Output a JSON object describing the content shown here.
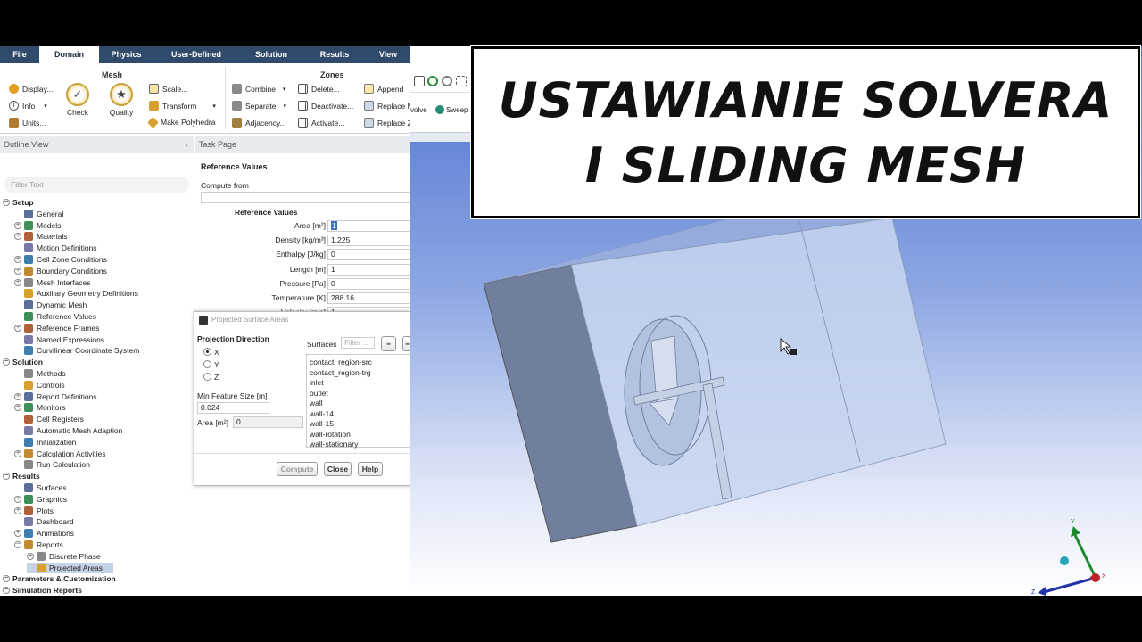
{
  "ribbon": {
    "tabs": [
      "File",
      "Domain",
      "Physics",
      "User-Defined",
      "Solution",
      "Results",
      "View"
    ],
    "active_tab": "Domain",
    "mesh_group": {
      "title": "Mesh",
      "display": "Display...",
      "info": "Info",
      "units": "Units...",
      "check": "Check",
      "quality": "Quality",
      "scale": "Scale...",
      "transform": "Transform",
      "make_polyhedra": "Make Polyhedra"
    },
    "zones_group": {
      "title": "Zones",
      "combine": "Combine",
      "separate": "Separate",
      "adjacency": "Adjacency...",
      "delete": "Delete...",
      "deactivate": "Deactivate...",
      "activate": "Activate...",
      "append": "Append",
      "replace_mesh": "Replace M",
      "replace_zone": "Replace Z"
    }
  },
  "outline": {
    "title": "Outline View",
    "filter_placeholder": "Filter Text",
    "items": [
      {
        "label": "Setup",
        "section": true
      },
      {
        "label": "General"
      },
      {
        "label": "Models",
        "expandable": true
      },
      {
        "label": "Materials",
        "expandable": true
      },
      {
        "label": "Motion Definitions"
      },
      {
        "label": "Cell Zone Conditions",
        "expandable": true
      },
      {
        "label": "Boundary Conditions",
        "expandable": true
      },
      {
        "label": "Mesh Interfaces",
        "expandable": true
      },
      {
        "label": "Auxiliary Geometry Definitions"
      },
      {
        "label": "Dynamic Mesh"
      },
      {
        "label": "Reference Values"
      },
      {
        "label": "Reference Frames",
        "expandable": true
      },
      {
        "label": "Named Expressions"
      },
      {
        "label": "Curvilinear Coordinate System"
      },
      {
        "label": "Solution",
        "section": true
      },
      {
        "label": "Methods"
      },
      {
        "label": "Controls"
      },
      {
        "label": "Report Definitions",
        "expandable": true
      },
      {
        "label": "Monitors",
        "expandable": true
      },
      {
        "label": "Cell Registers"
      },
      {
        "label": "Automatic Mesh Adaption"
      },
      {
        "label": "Initialization"
      },
      {
        "label": "Calculation Activities",
        "expandable": true
      },
      {
        "label": "Run Calculation"
      },
      {
        "label": "Results",
        "section": true
      },
      {
        "label": "Surfaces"
      },
      {
        "label": "Graphics",
        "expandable": true
      },
      {
        "label": "Plots",
        "expandable": true
      },
      {
        "label": "Dashboard"
      },
      {
        "label": "Animations",
        "expandable": true
      },
      {
        "label": "Reports",
        "expandable": true,
        "expanded": true
      },
      {
        "label": "Discrete Phase",
        "expandable": true,
        "child": true
      },
      {
        "label": "Projected Areas",
        "child": true,
        "selected": true
      },
      {
        "label": "Parameters & Customization",
        "section": true
      },
      {
        "label": "Simulation Reports",
        "section": true
      }
    ]
  },
  "task_page": {
    "title": "Task Page",
    "heading": "Reference Values",
    "compute_from_label": "Compute from",
    "group_label": "Reference Values",
    "fields": [
      {
        "label": "Area [m²]",
        "value": "1"
      },
      {
        "label": "Density [kg/m³]",
        "value": "1.225"
      },
      {
        "label": "Enthalpy [J/kg]",
        "value": "0"
      },
      {
        "label": "Length [m]",
        "value": "1"
      },
      {
        "label": "Pressure [Pa]",
        "value": "0"
      },
      {
        "label": "Temperature [K]",
        "value": "288.16"
      },
      {
        "label": "Velocity [m/s]",
        "value": "1"
      }
    ]
  },
  "dialog": {
    "title": "Projected Surface Areas",
    "projection_label": "Projection Direction",
    "options": [
      "X",
      "Y",
      "Z"
    ],
    "selected_option": "X",
    "surfaces_label": "Surfaces",
    "filter_placeholder": "Filter ...",
    "surfaces": [
      "contact_region-src",
      "contact_region-trg",
      "inlet",
      "outlet",
      "wall",
      "wall-14",
      "wall-15",
      "wall-rotation",
      "wall-stationary"
    ],
    "min_feature_label": "Min Feature Size [m]",
    "min_feature_value": "0.024",
    "area_label": "Area [m²]",
    "area_value": "0",
    "buttons": {
      "compute": "Compute",
      "close": "Close",
      "help": "Help"
    }
  },
  "viewport": {
    "toolbar": {
      "revolve": "volve",
      "sweep": "Sweep"
    },
    "axes": {
      "x": "X",
      "y": "Y",
      "z": "Z"
    }
  },
  "overlay": {
    "line1": "USTAWIANIE SOLVERA",
    "line2": "I SLIDING MESH"
  },
  "colors": {
    "ribbon_bar": "#2f4a6b",
    "selection": "#c5d4e6",
    "axis_x": "#c0202a",
    "axis_y": "#1e8a2e",
    "axis_z": "#2233aa"
  }
}
